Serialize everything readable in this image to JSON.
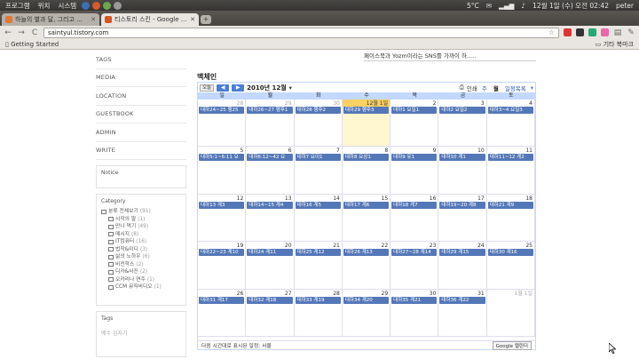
{
  "system": {
    "menus": [
      "프로그램",
      "위치",
      "시스템"
    ],
    "weather": "5°C",
    "clock": "12월 1일 (수) 오전 02:42",
    "user": "peter"
  },
  "tabs": [
    {
      "title": "하늘의 별과 달, 그리고 ...",
      "active": false,
      "favicon_color": "#e07a2e"
    },
    {
      "title": "티스토리 스킨 - Google ...",
      "active": true,
      "favicon_color": "#d9541e"
    }
  ],
  "toolbar": {
    "back": "←",
    "forward": "→",
    "reload": "C",
    "url": "saintyul.tistory.com",
    "star": "☆"
  },
  "bookmarks": {
    "left": "Getting Started",
    "right": "기타 북마크"
  },
  "sidebar": {
    "links": [
      "TAGS",
      "MEDIA",
      "LOCATION",
      "GUESTBOOK",
      "ADMIN",
      "WRITE"
    ],
    "notice_title": "Notice",
    "category_title": "Category",
    "categories": [
      {
        "label": "분류 전체보기",
        "count": "(91)",
        "indent": 0
      },
      {
        "label": "시작의 말",
        "count": "(1)",
        "indent": 1
      },
      {
        "label": "만나 먹기",
        "count": "(49)",
        "indent": 1
      },
      {
        "label": "메시지",
        "count": "(8)",
        "indent": 1
      },
      {
        "label": "IT컴퓨터",
        "count": "(16)",
        "indent": 1
      },
      {
        "label": "법학&미디",
        "count": "(3)",
        "indent": 1
      },
      {
        "label": "삶의 노하우",
        "count": "(6)",
        "indent": 1
      },
      {
        "label": "비전학스",
        "count": "(2)",
        "indent": 1
      },
      {
        "label": "디카&사진",
        "count": "(2)",
        "indent": 1
      },
      {
        "label": "오카리나 연주",
        "count": "(1)",
        "indent": 1
      },
      {
        "label": "CCM 뮤직비디오",
        "count": "(1)",
        "indent": 1
      }
    ],
    "tags_title": "Tags",
    "tags_text": "예수 십자가"
  },
  "main": {
    "notice_line": "페이스북과 Yozm이라는 SNS를 가까이 하.....",
    "blog_title": "맥체인"
  },
  "calendar": {
    "today_label": "오늘",
    "prev": "◀",
    "next": "▶",
    "month_label": "2010년 12월",
    "dropdown": "▾",
    "print_label": "인쇄",
    "view_week": "주",
    "view_month": "월",
    "view_agenda": "일정목록",
    "day_headers": [
      "일",
      "월",
      "화",
      "수",
      "목",
      "금",
      "토"
    ],
    "weeks": [
      [
        {
          "d": "28",
          "other": true,
          "evt": "대하24~25 행25"
        },
        {
          "d": "29",
          "other": true,
          "evt": "대하26~27 행후1"
        },
        {
          "d": "30",
          "other": true,
          "evt": "대하28 행후2"
        },
        {
          "d": "12월 1일",
          "today": true,
          "evt": "대하29 행후3"
        },
        {
          "d": "2",
          "evt": "대하1 요일1"
        },
        {
          "d": "3",
          "evt": "대하2 요일2"
        },
        {
          "d": "4",
          "evt": "대하3~4 요일3"
        }
      ],
      [
        {
          "d": "5",
          "evt": "대하5:1~6:11 요"
        },
        {
          "d": "6",
          "evt": "대하6:12~42 요"
        },
        {
          "d": "7",
          "evt": "대하7 요이1"
        },
        {
          "d": "8",
          "evt": "대하8 요삼1"
        },
        {
          "d": "9",
          "evt": "대하9 유1"
        },
        {
          "d": "10",
          "evt": "대하10 계1"
        },
        {
          "d": "11",
          "evt": "대하11~12 계2"
        }
      ],
      [
        {
          "d": "12",
          "evt": "대하13 계3"
        },
        {
          "d": "13",
          "evt": "대하14~15 계4"
        },
        {
          "d": "14",
          "evt": "대하16 계5"
        },
        {
          "d": "15",
          "evt": "대하17 계6"
        },
        {
          "d": "16",
          "evt": "대하18 계7"
        },
        {
          "d": "17",
          "evt": "대하19~20 계8"
        },
        {
          "d": "18",
          "evt": "대하21 계9"
        }
      ],
      [
        {
          "d": "19",
          "evt": "대하22~23 계10"
        },
        {
          "d": "20",
          "evt": "대하24 계11"
        },
        {
          "d": "21",
          "evt": "대하25 계12"
        },
        {
          "d": "22",
          "evt": "대하26 계13"
        },
        {
          "d": "23",
          "evt": "대하27~28 계14"
        },
        {
          "d": "24",
          "evt": "대하29 계15"
        },
        {
          "d": "25",
          "evt": "대하30 계16"
        }
      ],
      [
        {
          "d": "26",
          "evt": "대하31 계17"
        },
        {
          "d": "27",
          "evt": "대하32 계18"
        },
        {
          "d": "28",
          "evt": "대하33 계19"
        },
        {
          "d": "29",
          "evt": "대하34 계20"
        },
        {
          "d": "30",
          "evt": "대하35 계21"
        },
        {
          "d": "31",
          "evt": "대하36 계22"
        },
        {
          "d": "1월 1일",
          "other": true,
          "evt": ""
        }
      ]
    ],
    "footer_text": "다음 시간대로 표시된 일정: 서울",
    "google_badge": "Google 캘린더"
  },
  "colors": {
    "event_blue": "#5478b7",
    "today_yellow": "#fff7cf",
    "header_blue": "#c3d9ff"
  }
}
